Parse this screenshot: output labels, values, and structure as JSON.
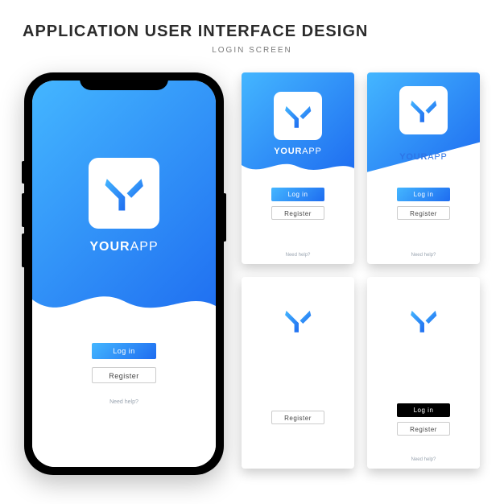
{
  "header": {
    "title": "APPLICATION USER INTERFACE DESIGN",
    "subtitle": "LOGIN SCREEN"
  },
  "brand": {
    "name_bold": "YOUR",
    "name_light": "APP"
  },
  "actions": {
    "login": "Log in",
    "register": "Register",
    "help": "Need help?"
  },
  "colors": {
    "grad_a": "#44b6ff",
    "grad_b": "#1e6cf0",
    "dark": "#000000"
  }
}
